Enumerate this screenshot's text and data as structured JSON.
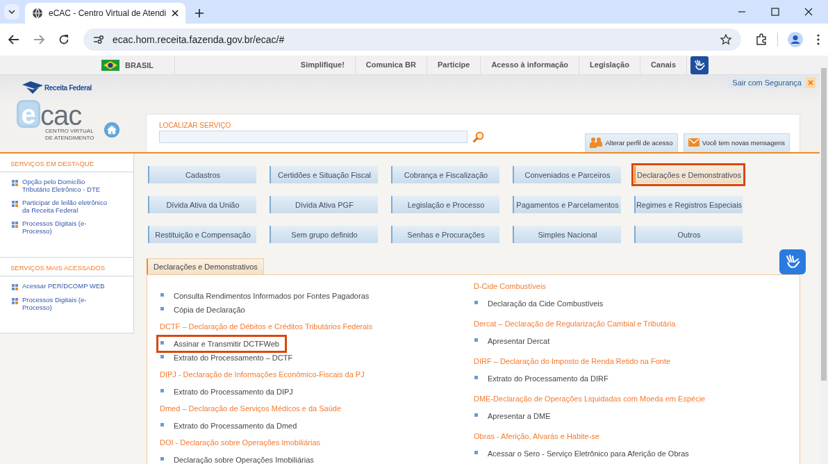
{
  "browser": {
    "tab_title": "eCAC - Centro Virtual de Atendi",
    "url": "ecac.hom.receita.fazenda.gov.br/ecac/#"
  },
  "gov_bar": {
    "country": "BRASIL",
    "links": [
      "Simplifique!",
      "Comunica BR",
      "Participe",
      "Acesso à informação",
      "Legislação",
      "Canais"
    ]
  },
  "header": {
    "agency": "Receita Federal",
    "logo_e": "e",
    "logo_rest": "cac",
    "logo_subtitle": [
      "CENTRO VIRTUAL",
      "DE ATENDIMENTO"
    ],
    "logout": "Sair com Segurança",
    "search_label": "LOCALIZAR SERVIÇO",
    "profile_button": "Alterar perfil de acesso",
    "messages_button": "Você tem novas mensagens"
  },
  "sidebar": [
    {
      "title": "SERVIÇOS EM DESTAQUE",
      "items": [
        "Opção pelo Domicílio Tributário Eletrônico - DTE",
        "Participar de leilão eletrônico da Receita Federal",
        "Processos Digitais (e-Processo)"
      ]
    },
    {
      "title": "SERVIÇOS MAIS ACESSADOS",
      "items": [
        "Acessar PER/DCOMP WEB",
        "Processos Digitais (e-Processo)"
      ]
    }
  ],
  "categories": [
    {
      "label": "Cadastros",
      "selected": false
    },
    {
      "label": "Certidões e Situação Fiscal",
      "selected": false
    },
    {
      "label": "Cobrança e Fiscalização",
      "selected": false
    },
    {
      "label": "Conveniados e Parceiros",
      "selected": false
    },
    {
      "label": "Declarações e Demonstrativos",
      "selected": true
    },
    {
      "label": "Dívida Ativa da União",
      "selected": false
    },
    {
      "label": "Dívida Ativa PGF",
      "selected": false
    },
    {
      "label": "Legislação e Processo",
      "selected": false
    },
    {
      "label": "Pagamentos e Parcelamentos",
      "selected": false
    },
    {
      "label": "Regimes e Registros Especiais",
      "selected": false
    },
    {
      "label": "Restituição e Compensação",
      "selected": false
    },
    {
      "label": "Sem grupo definido",
      "selected": false
    },
    {
      "label": "Senhas e Procurações",
      "selected": false
    },
    {
      "label": "Simples Nacional",
      "selected": false
    },
    {
      "label": "Outros",
      "selected": false
    }
  ],
  "panel": {
    "tab": "Declarações e Demonstrativos",
    "columns": [
      [
        {
          "items": [
            {
              "label": "Consulta Rendimentos Informados por Fontes Pagadoras",
              "highlighted": false
            },
            {
              "label": "Cópia de Declaração",
              "highlighted": false
            }
          ]
        },
        {
          "heading": "DCTF – Declaração de Débitos e Créditos Tributários Federais",
          "items": [
            {
              "label": "Assinar e Transmitir DCTFWeb",
              "highlighted": true
            },
            {
              "label": "Extrato do Processamento – DCTF",
              "highlighted": false
            }
          ]
        },
        {
          "heading": "DIPJ - Declaração de Informações Econômico-Fiscais da PJ",
          "items": [
            {
              "label": "Extrato do Processamento da DIPJ",
              "highlighted": false
            }
          ]
        },
        {
          "heading": "Dmed – Declaração de Serviços Médicos e da Saúde",
          "items": [
            {
              "label": "Extrato do Processamento da Dmed",
              "highlighted": false
            }
          ]
        },
        {
          "heading": "DOI - Declaração sobre Operações Imobiliárias",
          "items": [
            {
              "label": "Declaração sobre Operações Imobiliárias",
              "highlighted": false
            }
          ]
        }
      ],
      [
        {
          "heading": "D-Cide Combustíveis",
          "items": [
            {
              "label": "Declaração da Cide Combustíveis",
              "highlighted": false
            }
          ]
        },
        {
          "heading": "Dercat – Declaração de Regularização Cambial e Tributária",
          "items": [
            {
              "label": "Apresentar Dercat",
              "highlighted": false
            }
          ]
        },
        {
          "heading": "DIRF – Declaração do Imposto de Renda Retido na Fonte",
          "items": [
            {
              "label": "Extrato do Processamento da DIRF",
              "highlighted": false
            }
          ]
        },
        {
          "heading": "DME-Declaração de Operações Liquidadas com Moeda em Espécie",
          "items": [
            {
              "label": "Apresentar a DME",
              "highlighted": false
            }
          ]
        },
        {
          "heading": "Obras - Aferição, Alvarás e Habite-se",
          "items": [
            {
              "label": "Acessar o Sero - Serviço Eletrônico para Aferição de Obras",
              "highlighted": false
            }
          ]
        }
      ]
    ]
  }
}
